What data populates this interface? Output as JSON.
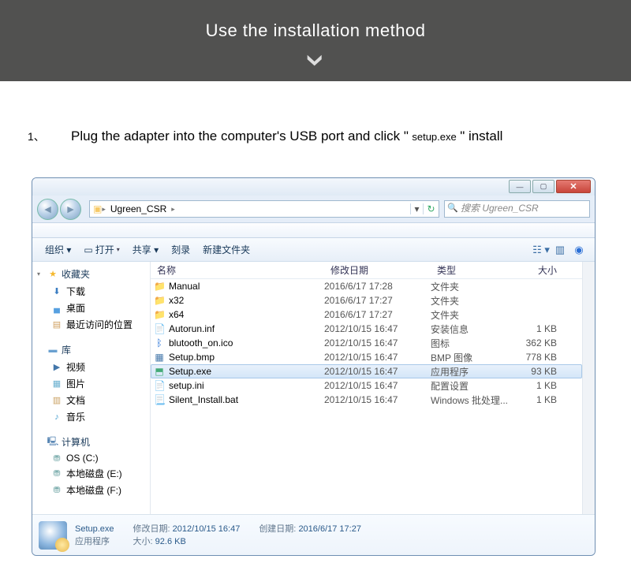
{
  "banner": {
    "title": "Use the installation method"
  },
  "instruction": {
    "number": "1、",
    "text": "Plug the adapter into the computer's USB port and click \"",
    "code": "setup.exe",
    "after": "\"  install"
  },
  "addr": {
    "icon": "▣",
    "crumb1": "Ugreen_CSR",
    "search_placeholder": "搜索 Ugreen_CSR"
  },
  "menubar": "",
  "toolbar": {
    "organize": "组织 ▾",
    "open": "打开",
    "share": "共享 ▾",
    "burn": "刻录",
    "newfolder": "新建文件夹"
  },
  "cols": {
    "name": "名称",
    "date": "修改日期",
    "type": "类型",
    "size": "大小"
  },
  "tree": {
    "fav": "收藏夹",
    "downloads": "下载",
    "desktop": "桌面",
    "recent": "最近访问的位置",
    "libs": "库",
    "videos": "视频",
    "pictures": "图片",
    "documents": "文档",
    "music": "音乐",
    "computer": "计算机",
    "osc": "OS (C:)",
    "de": "本地磁盘 (E:)",
    "df": "本地磁盘 (F:)"
  },
  "files": [
    {
      "icon": "📁",
      "ic": "i-folder",
      "name": "Manual",
      "date": "2016/6/17 17:28",
      "type": "文件夹",
      "size": ""
    },
    {
      "icon": "📁",
      "ic": "i-folder",
      "name": "x32",
      "date": "2016/6/17 17:27",
      "type": "文件夹",
      "size": ""
    },
    {
      "icon": "📁",
      "ic": "i-folder",
      "name": "x64",
      "date": "2016/6/17 17:27",
      "type": "文件夹",
      "size": ""
    },
    {
      "icon": "📄",
      "ic": "i-ini",
      "name": "Autorun.inf",
      "date": "2012/10/15 16:47",
      "type": "安装信息",
      "size": "1 KB"
    },
    {
      "icon": "ᛒ",
      "ic": "i-bt",
      "name": "blutooth_on.ico",
      "date": "2012/10/15 16:47",
      "type": "图标",
      "size": "362 KB"
    },
    {
      "icon": "▦",
      "ic": "i-bmp",
      "name": "Setup.bmp",
      "date": "2012/10/15 16:47",
      "type": "BMP 图像",
      "size": "778 KB"
    },
    {
      "icon": "⬒",
      "ic": "i-exe",
      "name": "Setup.exe",
      "date": "2012/10/15 16:47",
      "type": "应用程序",
      "size": "93 KB",
      "selected": true
    },
    {
      "icon": "📄",
      "ic": "i-ini",
      "name": "setup.ini",
      "date": "2012/10/15 16:47",
      "type": "配置设置",
      "size": "1 KB"
    },
    {
      "icon": "📃",
      "ic": "i-bat",
      "name": "Silent_Install.bat",
      "date": "2012/10/15 16:47",
      "type": "Windows 批处理...",
      "size": "1 KB"
    }
  ],
  "details": {
    "name": "Setup.exe",
    "type": "应用程序",
    "mod_k": "修改日期:",
    "mod_v": "2012/10/15 16:47",
    "size_k": "大小:",
    "size_v": "92.6 KB",
    "cre_k": "创建日期:",
    "cre_v": "2016/6/17 17:27"
  }
}
